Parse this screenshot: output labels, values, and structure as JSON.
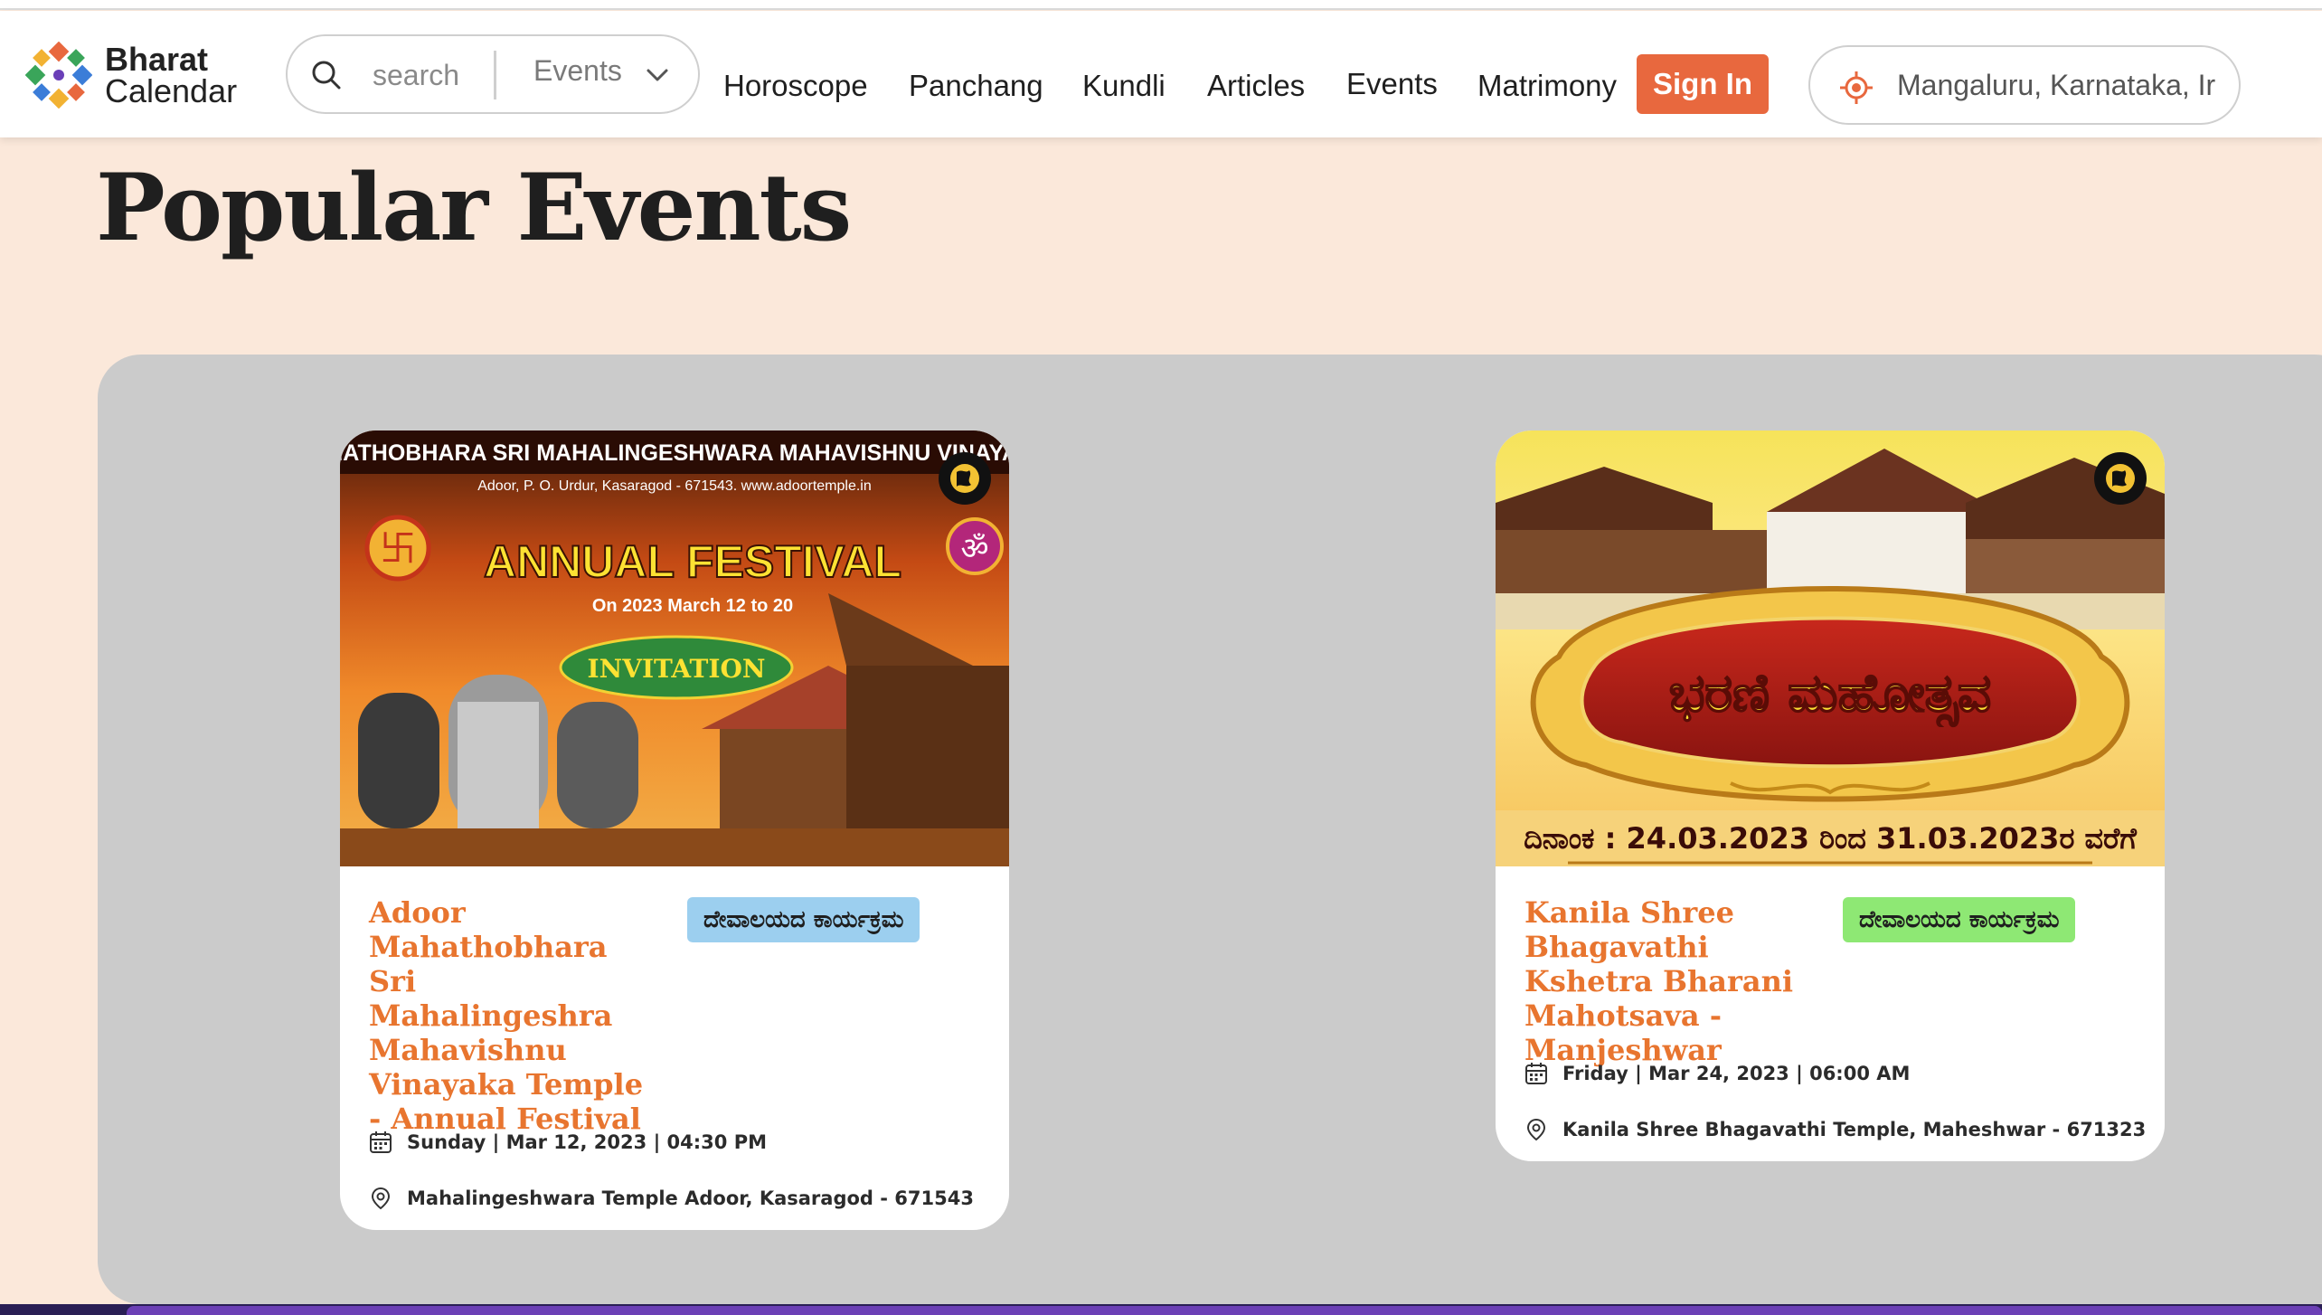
{
  "header": {
    "logo": {
      "line1": "Bharat",
      "line2": "Calendar"
    },
    "search": {
      "placeholder": "search",
      "value": "",
      "category": "Events"
    },
    "nav_links": [
      "Horoscope",
      "Panchang",
      "Kundli",
      "Articles",
      "Events",
      "Matrimony"
    ],
    "sign_in_label": "Sign In",
    "location": "Mangaluru, Karnataka, Ir"
  },
  "colors": {
    "brand_accent": "#e8683e",
    "page_background": "#fbe8da",
    "panel_background": "#cbcbcb",
    "card_title": "#e8752f",
    "badge_blue": "#9ccfef",
    "badge_green": "#8ee874"
  },
  "main": {
    "title": "Popular Events",
    "events": [
      {
        "title": "Adoor Mahathobhara Sri Mahalingeshra Mahavishnu Vinayaka Temple - Annual Festival",
        "category": "ದೇವಾಲಯದ ಕಾರ್ಯಕ್ರಮ",
        "datetime": "Sunday | Mar 12, 2023 | 04:30 PM",
        "venue": "Mahalingeshwara Temple Adoor, Kasaragod - 671543",
        "image": {
          "banner": "ADOOR MAHATHOBHARA SRI MAHALINGESHWARA MAHAVISHNU VINAYAKA TEMPLE",
          "address": "Adoor, P. O. Urdur, Kasaragod - 671543.  www.adoortemple.in",
          "heading": "ANNUAL FESTIVAL",
          "dates": "On 2023 March 12 to 20",
          "tag": "INVITATION"
        }
      },
      {
        "title": "Kanila Shree Bhagavathi Kshetra Bharani Mahotsava - Manjeshwar",
        "category": "ದೇವಾಲಯದ ಕಾರ್ಯಕ್ರಮ",
        "datetime": "Friday | Mar 24, 2023 | 06:00 AM",
        "venue": "Kanila Shree Bhagavathi Temple, Maheshwar - 671323",
        "image": {
          "heading": "ಭರಣಿ ಮಹೋತ್ಸವ",
          "dates": "ದಿನಾಂಕ : 24.03.2023 ರಿಂದ 31.03.2023ರ ವರೆಗೆ"
        }
      }
    ]
  },
  "icons": {
    "search": "search-icon",
    "chevron": "chevron-down-icon",
    "location": "location-target-icon",
    "globe": "globe-icon",
    "calendar": "calendar-icon",
    "pin": "map-pin-icon"
  }
}
